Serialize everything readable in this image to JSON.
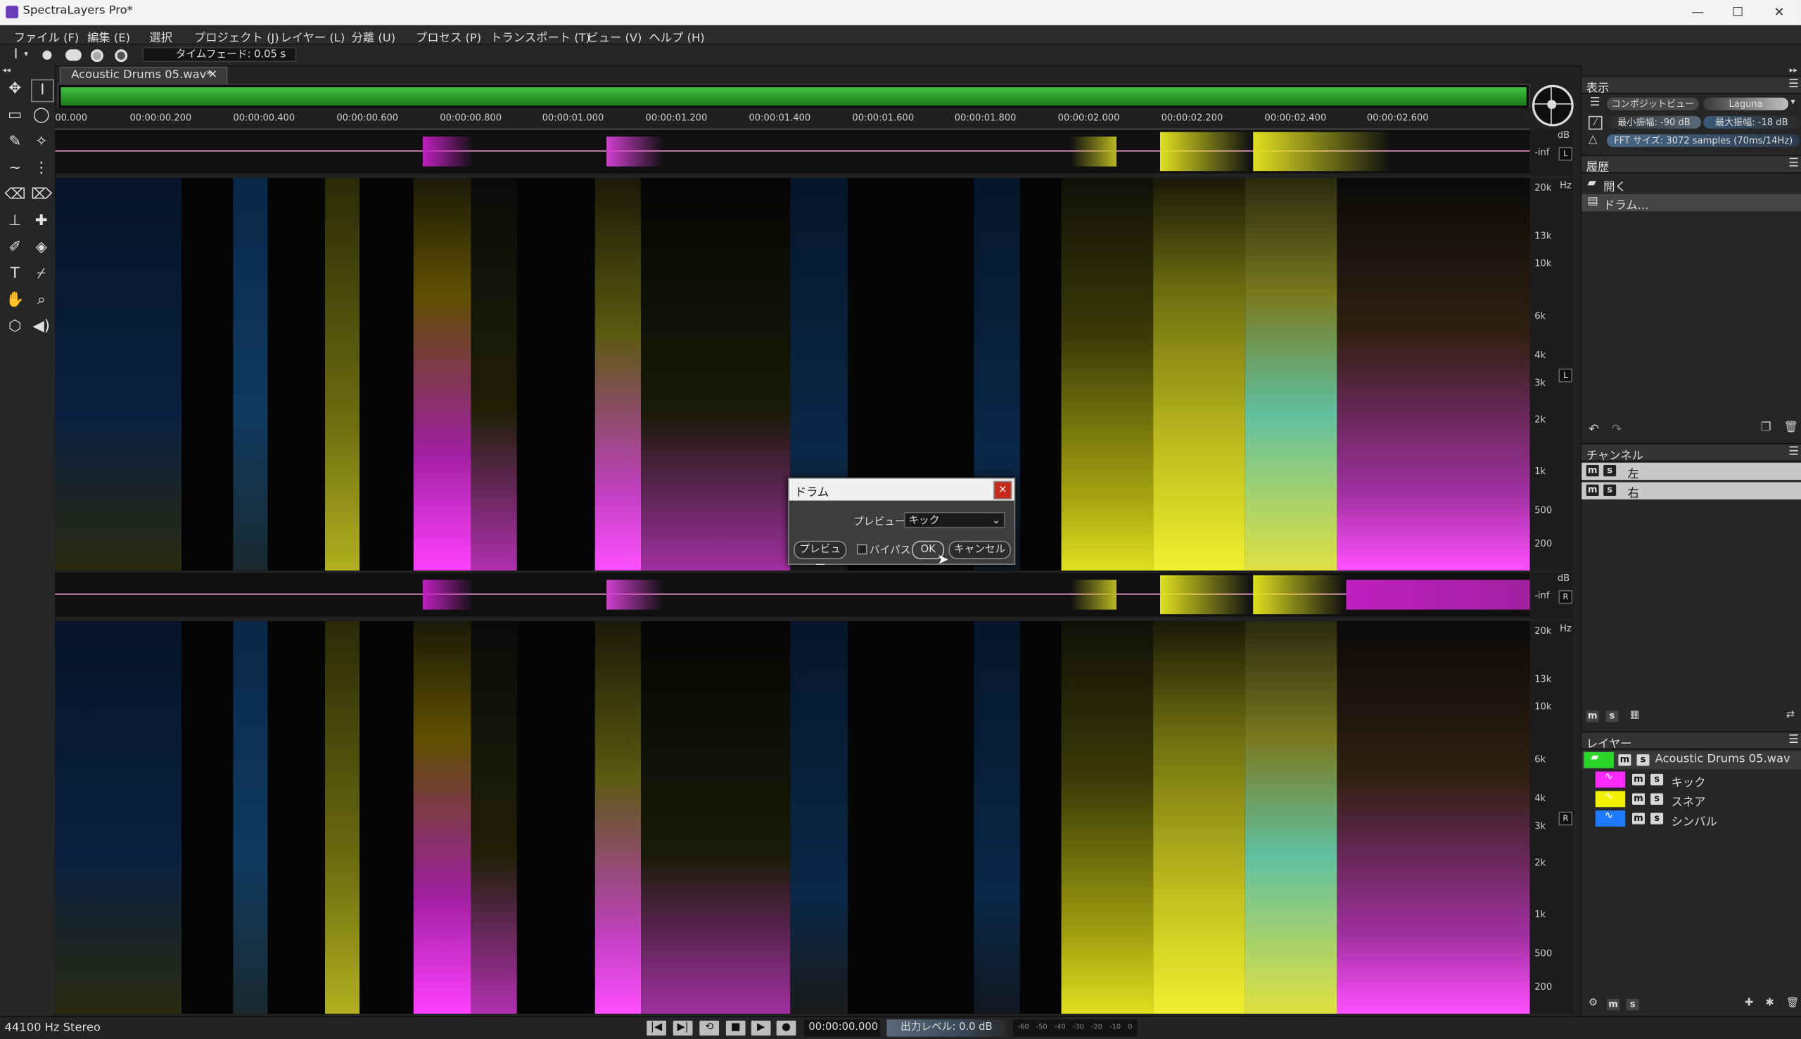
{
  "window": {
    "title": "SpectraLayers Pro*",
    "min": "—",
    "max": "☐",
    "close": "✕"
  },
  "menu": [
    "ファイル (F)",
    "編集 (E)",
    "選択",
    "プロジェクト (J)",
    "レイヤー (L)",
    "分離 (U)",
    "プロセス (P)",
    "トランスポート (T)",
    "ビュー (V)",
    "ヘルプ (H)"
  ],
  "toolbar": {
    "cursor_label": "I",
    "time_fade": "タイムフェード: 0.05 s"
  },
  "tab": {
    "label": "Acoustic Drums 05.wav*",
    "close": "✕"
  },
  "ruler": [
    "00.000",
    "00:00:00.200",
    "00:00:00.400",
    "00:00:00.600",
    "00:00:00.800",
    "00:00:01.000",
    "00:00:01.200",
    "00:00:01.400",
    "00:00:01.600",
    "00:00:01.800",
    "00:00:02.000",
    "00:00:02.200",
    "00:00:02.400",
    "00:00:02.600"
  ],
  "wave": {
    "db": "dB",
    "inf": "-inf",
    "channel_left": "L",
    "channel_right": "R"
  },
  "freq_scale": {
    "unit": "Hz",
    "labels": [
      "20k",
      "13k",
      "10k",
      "6k",
      "4k",
      "3k",
      "2k",
      "1k",
      "500",
      "200"
    ]
  },
  "display_panel": {
    "title": "表示",
    "composite_view": "コンポジットビュー",
    "colormap": "Laguna",
    "min_amp": "最小振幅: -90 dB",
    "max_amp": "最大振幅: -18 dB",
    "fft": "FFT サイズ: 3072 samples (70ms/14Hz)"
  },
  "history_panel": {
    "title": "履歴",
    "items": [
      "開く",
      "ドラム..."
    ]
  },
  "channels_panel": {
    "title": "チャンネル",
    "items": [
      "左",
      "右"
    ],
    "m": "m",
    "s": "s"
  },
  "layers_panel": {
    "title": "レイヤー",
    "items": [
      {
        "name": "Acoustic Drums 05.wav",
        "color": "#2bd62b"
      },
      {
        "name": "キック",
        "color": "#ff2bff"
      },
      {
        "name": "スネア",
        "color": "#f0f000"
      },
      {
        "name": "シンバル",
        "color": "#1e7bff"
      }
    ]
  },
  "status": {
    "format": "44100 Hz Stereo",
    "time": "00:00:00.000",
    "output_level": "出力レベル: 0.0 dB",
    "meter_labels": [
      "-60",
      "-50",
      "-40",
      "-30",
      "-20",
      "-10",
      "0"
    ]
  },
  "dialog": {
    "title": "ドラム",
    "close": "×",
    "preview_label": "プレビュー:",
    "preview_value": "キック",
    "preview_button": "プレビュー",
    "bypass": "バイパス",
    "ok": "OK",
    "cancel": "キャンセル"
  }
}
